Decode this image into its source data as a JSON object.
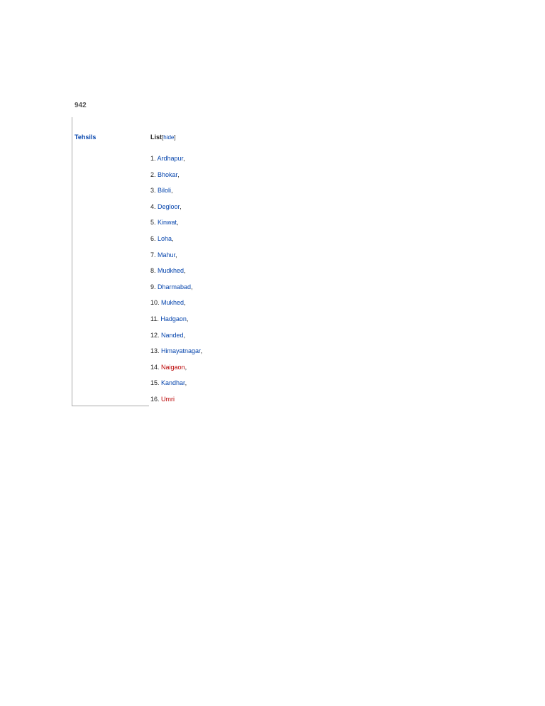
{
  "page_number": "942",
  "infobox": {
    "label": "Tehsils",
    "list_heading": "List",
    "hide_open": "[",
    "hide_label": "hide",
    "hide_close": "]"
  },
  "tehsils": [
    {
      "num": "1.",
      "name": "Ardhapur",
      "sep": ",",
      "link": "blue"
    },
    {
      "num": "2.",
      "name": "Bhokar",
      "sep": ",",
      "link": "blue"
    },
    {
      "num": "3.",
      "name": "Biloli",
      "sep": ",",
      "link": "blue"
    },
    {
      "num": "4.",
      "name": "Degloor",
      "sep": ",",
      "link": "blue"
    },
    {
      "num": "5.",
      "name": "Kinwat",
      "sep": ",",
      "link": "blue"
    },
    {
      "num": "6.",
      "name": "Loha",
      "sep": ",",
      "link": "blue"
    },
    {
      "num": "7.",
      "name": "Mahur",
      "sep": ",",
      "link": "blue"
    },
    {
      "num": "8.",
      "name": "Mudkhed",
      "sep": ",",
      "link": "blue"
    },
    {
      "num": "9.",
      "name": "Dharmabad",
      "sep": ",",
      "link": "blue"
    },
    {
      "num": "10.",
      "name": "Mukhed",
      "sep": ",",
      "link": "blue"
    },
    {
      "num": "11.",
      "name": "Hadgaon",
      "sep": ",",
      "link": "blue"
    },
    {
      "num": "12.",
      "name": "Nanded",
      "sep": ",",
      "link": "blue"
    },
    {
      "num": "13.",
      "name": "Himayatnagar",
      "sep": ",",
      "link": "blue"
    },
    {
      "num": "14.",
      "name": "Naigaon",
      "sep": ",",
      "link": "red"
    },
    {
      "num": "15.",
      "name": "Kandhar",
      "sep": ",",
      "link": "blue"
    },
    {
      "num": "16.",
      "name": "Umri",
      "sep": "",
      "link": "red"
    }
  ],
  "colors": {
    "link_blue": "#0645ad",
    "link_red": "#ba0000",
    "text": "#222222",
    "border": "#a8a8a8"
  }
}
